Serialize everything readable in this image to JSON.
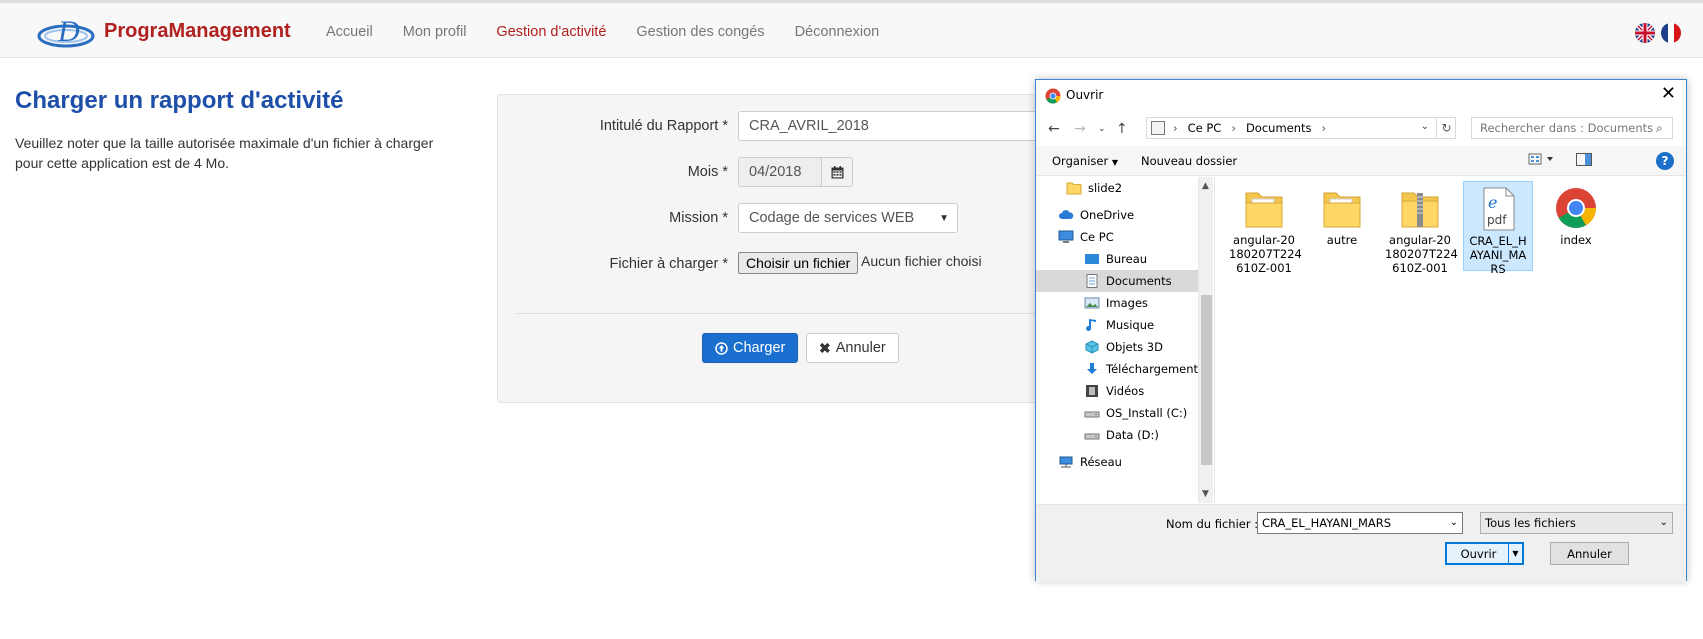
{
  "brand": {
    "name": "PrograManagement"
  },
  "nav": {
    "items": [
      "Accueil",
      "Mon profil",
      "Gestion d'activité",
      "Gestion des congés",
      "Déconnexion"
    ],
    "active_index": 2
  },
  "page": {
    "title": "Charger un rapport d'activité",
    "note": "Veuillez noter que la taille autorisée maximale d'un fichier à charger pour cette application est de 4 Mo."
  },
  "form": {
    "report_label": "Intitulé du Rapport *",
    "report_value": "CRA_AVRIL_2018",
    "month_label": "Mois *",
    "month_value": "04/2018",
    "mission_label": "Mission *",
    "mission_value": "Codage de services WEB",
    "file_label": "Fichier à charger *",
    "file_button": "Choisir un fichier",
    "file_status": "Aucun fichier choisi",
    "submit_label": "Charger",
    "cancel_label": "Annuler"
  },
  "dialog": {
    "title": "Ouvrir",
    "breadcrumb": [
      "Ce PC",
      "Documents"
    ],
    "search_placeholder": "Rechercher dans : Documents",
    "toolbar": {
      "organize": "Organiser",
      "new_folder": "Nouveau dossier"
    },
    "tree": [
      {
        "label": "slide2",
        "icon": "folder-icon"
      },
      {
        "label": "OneDrive",
        "icon": "cloud-icon"
      },
      {
        "label": "Ce PC",
        "icon": "computer-icon"
      },
      {
        "label": "Bureau",
        "icon": "desktop-icon"
      },
      {
        "label": "Documents",
        "icon": "documents-icon",
        "selected": true
      },
      {
        "label": "Images",
        "icon": "images-icon"
      },
      {
        "label": "Musique",
        "icon": "music-icon"
      },
      {
        "label": "Objets 3D",
        "icon": "cube-icon"
      },
      {
        "label": "Téléchargements",
        "icon": "download-icon"
      },
      {
        "label": "Vidéos",
        "icon": "video-icon"
      },
      {
        "label": "OS_Install (C:)",
        "icon": "drive-icon"
      },
      {
        "label": "Data (D:)",
        "icon": "drive-icon"
      },
      {
        "label": "Réseau",
        "icon": "network-icon"
      }
    ],
    "files": [
      {
        "name": "angular-20180207T224610Z-001",
        "lines": [
          "angular-20",
          "180207T224",
          "610Z-001"
        ],
        "icon": "folder-icon"
      },
      {
        "name": "autre",
        "lines": [
          "autre"
        ],
        "icon": "folder-icon"
      },
      {
        "name": "angular-20180207T224610Z-001",
        "lines": [
          "angular-20",
          "180207T224",
          "610Z-001"
        ],
        "icon": "zip-folder-icon"
      },
      {
        "name": "CRA_EL_HAYANI_MARS",
        "lines": [
          "CRA_EL_H",
          "AYANI_MA",
          "RS"
        ],
        "icon": "pdf-icon",
        "selected": true
      },
      {
        "name": "index",
        "lines": [
          "index"
        ],
        "icon": "chrome-icon"
      }
    ],
    "filename_label": "Nom du fichier :",
    "filename_value": "CRA_EL_HAYANI_MARS",
    "filetype_value": "Tous les fichiers",
    "open_label": "Ouvrir",
    "cancel_label": "Annuler"
  },
  "colors": {
    "brand_red": "#b0201e",
    "title_blue": "#1d4ea8",
    "primary_blue": "#1b6fcf",
    "windows_blue": "#0078d7"
  }
}
